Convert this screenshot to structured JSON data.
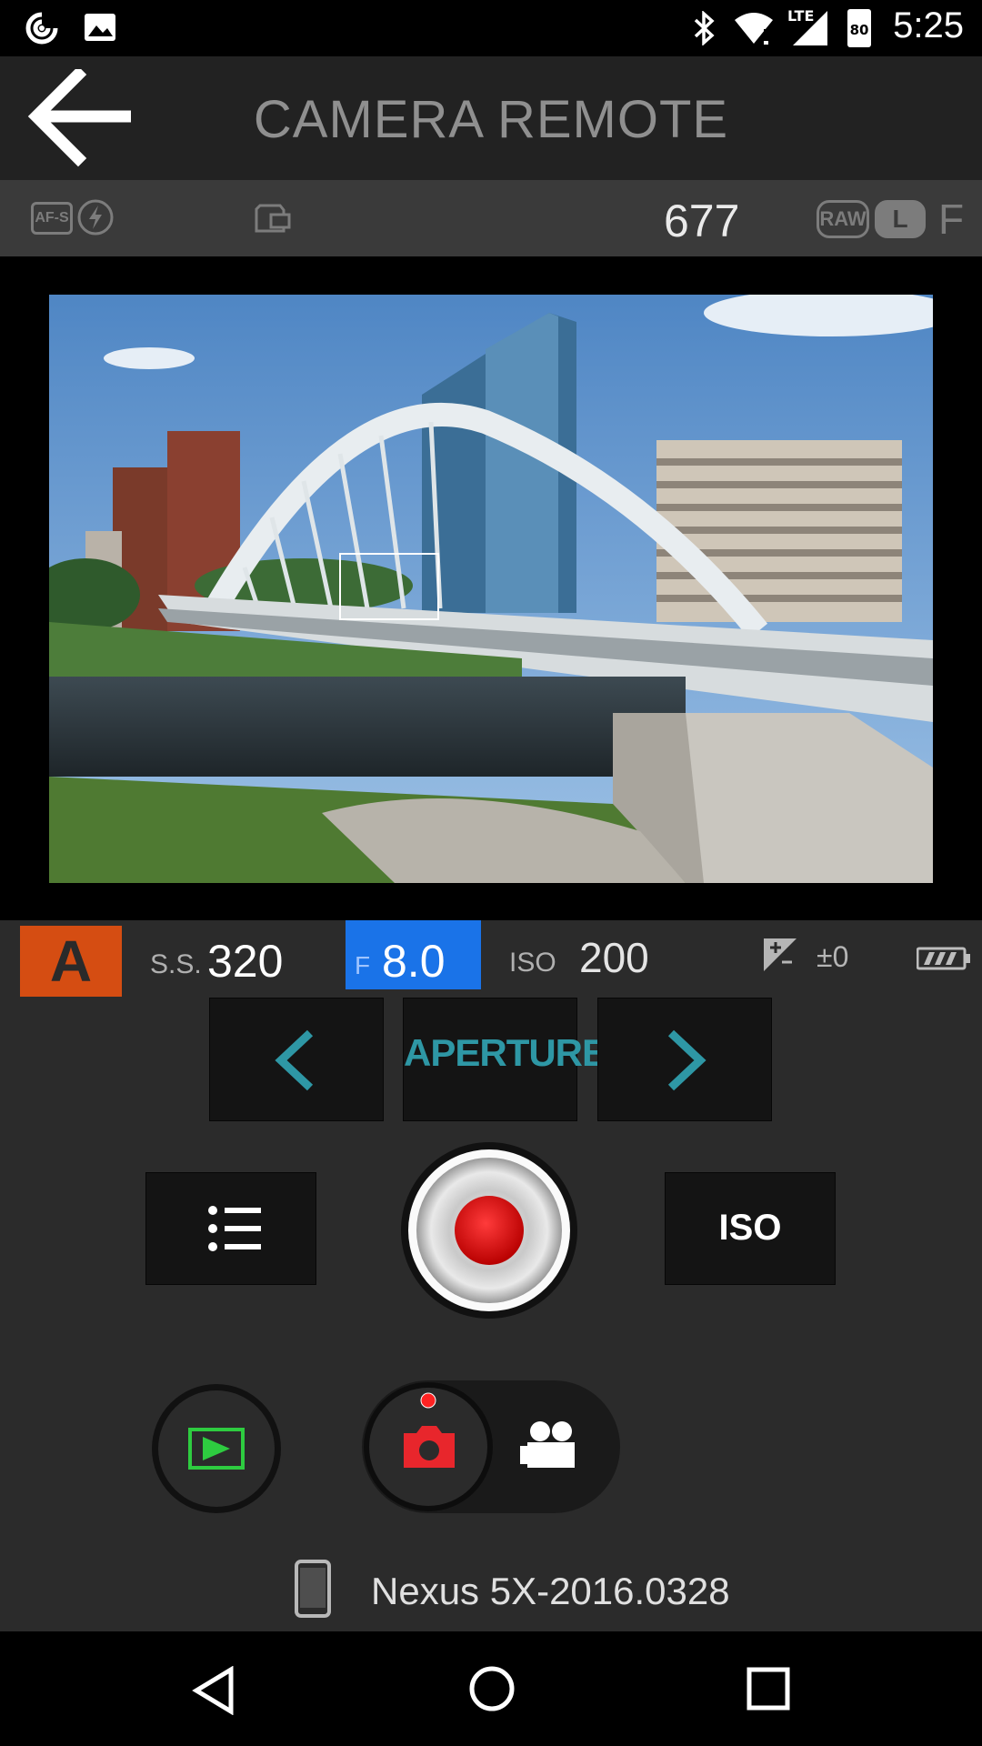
{
  "status_bar": {
    "time": "5:25",
    "network": "LTE",
    "battery_level": "80",
    "icons": [
      "sync-icon",
      "image-icon",
      "bluetooth-icon",
      "wifi-icon",
      "cell-signal-icon",
      "battery-icon"
    ]
  },
  "header": {
    "title": "CAMERA REMOTE",
    "back_icon": "back-arrow-icon"
  },
  "info_strip": {
    "focus_mode": "AF-S",
    "flash_icon": "flash-off-icon",
    "card_icon": "memory-card-icon",
    "shots_remaining": "677",
    "quality": "RAW",
    "size": "L",
    "fine": "F"
  },
  "preview": {
    "focus_box": true,
    "image_icon": "live-view-image"
  },
  "settings": {
    "mode": "A",
    "shutter_label": "S.S.",
    "shutter_value": "320",
    "aperture_label": "F",
    "aperture_value": "8.0",
    "iso_label": "ISO",
    "iso_value": "200",
    "exposure_comp_icon": "exposure-icon",
    "exposure_comp_value": "±0",
    "battery_icon": "camera-battery-icon",
    "selected_color": "#1a73e8",
    "mode_color": "#d54d12"
  },
  "controls": {
    "prev_icon": "chevron-left-icon",
    "param_label": "APERTURE",
    "next_icon": "chevron-right-icon",
    "menu_icon": "list-icon",
    "shutter_icon": "shutter-button",
    "iso_button_label": "ISO"
  },
  "mode_switch": {
    "playback_icon": "playback-icon",
    "photo_icon": "camera-icon",
    "video_icon": "video-camera-icon",
    "selected": "photo"
  },
  "device": {
    "icon": "phone-icon",
    "name": "Nexus 5X-2016.0328"
  },
  "nav_bar": {
    "back": "nav-back-icon",
    "home": "nav-home-icon",
    "recents": "nav-recents-icon"
  }
}
